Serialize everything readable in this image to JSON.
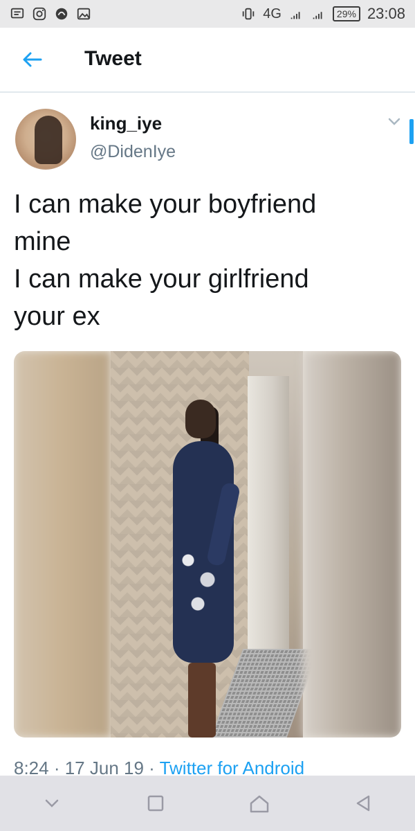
{
  "status_bar": {
    "left_icons": [
      "message-icon",
      "instagram-icon",
      "app-icon",
      "image-icon"
    ],
    "network": "4G",
    "battery": "29%",
    "time": "23:08"
  },
  "header": {
    "title": "Tweet",
    "back_icon": "back-arrow-icon"
  },
  "tweet": {
    "name": "king_iye",
    "handle": "@DidenIye",
    "text": "I can make your boyfriend\nmine\nI can make your girlfriend\nyour ex",
    "time": "8:24",
    "date": "17 Jun 19",
    "source": "Twitter for Android",
    "separator": " · "
  },
  "nav": {
    "buttons": [
      "chevron-down-icon",
      "recent-apps-icon",
      "home-icon",
      "back-icon"
    ]
  },
  "colors": {
    "accent": "#1da1f2",
    "text_primary": "#14171a",
    "text_secondary": "#657786"
  }
}
